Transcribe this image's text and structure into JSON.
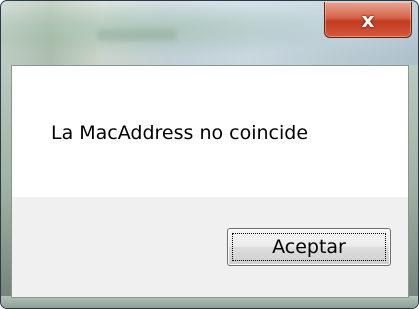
{
  "dialog": {
    "title": "",
    "message": "La MacAddress no coincide",
    "close_glyph": "x",
    "close_icon": "close-icon",
    "ok_label": "Aceptar"
  },
  "colors": {
    "close_button": "#c7432a",
    "client_background": "#ffffff",
    "footer_background": "#f0f0f0"
  }
}
